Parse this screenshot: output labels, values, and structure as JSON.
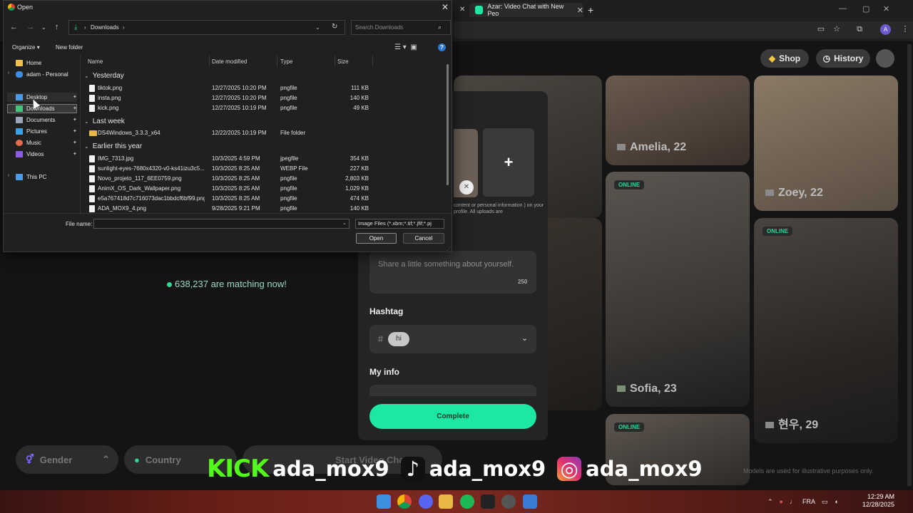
{
  "browser": {
    "tab_title": "Azar: Video Chat with New Peo",
    "tab_close": "✕",
    "new_tab": "+",
    "window_controls": [
      "—",
      "▢",
      "✕"
    ]
  },
  "site": {
    "shop_label": "Shop",
    "history_label": "History",
    "matching_text": "638,237 are matching now!",
    "cards": [
      {
        "name": "Amelia, 22",
        "online": false
      },
      {
        "name": "Zoey, 22",
        "online": false
      },
      {
        "name": "Sofia, 23",
        "online": true
      },
      {
        "name": "",
        "online": true
      },
      {
        "name": "현우, 29",
        "online": true
      }
    ],
    "online_badge": "ONLINE",
    "filters": {
      "gender": "Gender",
      "country": "Country",
      "start": "Start Video Chat"
    },
    "disclaimer": "Models are used for illustrative purposes only.",
    "accent_color": "#1ce8a4"
  },
  "profile_modal": {
    "upload_note": "content or personal information ) on your profile. All uploads are",
    "bio_placeholder": "Share a little something about yourself.",
    "bio_counter": "250",
    "hashtag_label": "Hashtag",
    "hashtag_symbol": "#",
    "hashtag_chip": "hi",
    "myinfo_label": "My info",
    "complete_label": "Complete"
  },
  "overlay": {
    "kick_logo": "KICK",
    "handle": "ada_mox9"
  },
  "dialog": {
    "title": "Open",
    "address_folder": "Downloads",
    "search_placeholder": "Search Downloads",
    "organize": "Organize",
    "new_folder": "New folder",
    "sidebar": [
      {
        "label": "Home",
        "icon": "home-icon",
        "color": "#f0c24b"
      },
      {
        "label": "adam - Personal",
        "icon": "onedrive-icon",
        "color": "#3a8ee6"
      },
      {
        "label": "Desktop",
        "icon": "desktop-icon",
        "color": "#4a9be8"
      },
      {
        "label": "Downloads",
        "icon": "download-icon",
        "color": "#3ec77a"
      },
      {
        "label": "Documents",
        "icon": "document-icon",
        "color": "#9aa6b8"
      },
      {
        "label": "Pictures",
        "icon": "pictures-icon",
        "color": "#3aa0e8"
      },
      {
        "label": "Music",
        "icon": "music-icon",
        "color": "#e86a4a"
      },
      {
        "label": "Videos",
        "icon": "videos-icon",
        "color": "#8a5ae8"
      },
      {
        "label": "This PC",
        "icon": "pc-icon",
        "color": "#4a9be8"
      }
    ],
    "columns": {
      "name": "Name",
      "date": "Date modified",
      "type": "Type",
      "size": "Size"
    },
    "groups": {
      "yesterday": "Yesterday",
      "last_week": "Last week",
      "earlier": "Earlier this year"
    },
    "files": [
      {
        "name": "tiktok.png",
        "date": "12/27/2025 10:20 PM",
        "type": "pngfile",
        "size": "111 KB"
      },
      {
        "name": "insta.png",
        "date": "12/27/2025 10:20 PM",
        "type": "pngfile",
        "size": "140 KB"
      },
      {
        "name": "kick.png",
        "date": "12/27/2025 10:19 PM",
        "type": "pngfile",
        "size": "49 KB"
      },
      {
        "name": "DS4Windows_3.3.3_x64",
        "date": "12/22/2025 10:19 PM",
        "type": "File folder",
        "size": ""
      },
      {
        "name": "IMG_7313.jpg",
        "date": "10/3/2025 4:59 PM",
        "type": "jpegfile",
        "size": "354 KB"
      },
      {
        "name": "sunlight-eyes-7680x4320-v0-ks41izu3c5...",
        "date": "10/3/2025 8:25 AM",
        "type": "WEBP File",
        "size": "227 KB"
      },
      {
        "name": "Novo_projeto_117_6EE0759.png",
        "date": "10/3/2025 8:25 AM",
        "type": "pngfile",
        "size": "2,803 KB"
      },
      {
        "name": "AnimX_OS_Dark_Wallpaper.png",
        "date": "10/3/2025 8:25 AM",
        "type": "pngfile",
        "size": "1,029 KB"
      },
      {
        "name": "e5a767418d7c716073dac1bbdcf6bf99.png",
        "date": "10/3/2025 8:25 AM",
        "type": "pngfile",
        "size": "474 KB"
      },
      {
        "name": "ADA_MOX9_4.png",
        "date": "9/28/2025 9:21 PM",
        "type": "pngfile",
        "size": "140 KB"
      }
    ],
    "filename_label": "File name:",
    "filename_value": "",
    "filter_value": "Image Files (*.xbm;*.tif;*.jfif;*.pj",
    "open_label": "Open",
    "cancel_label": "Cancel"
  },
  "taskbar": {
    "lang": "FRA",
    "time": "12:29 AM",
    "date": "12/28/2025"
  }
}
